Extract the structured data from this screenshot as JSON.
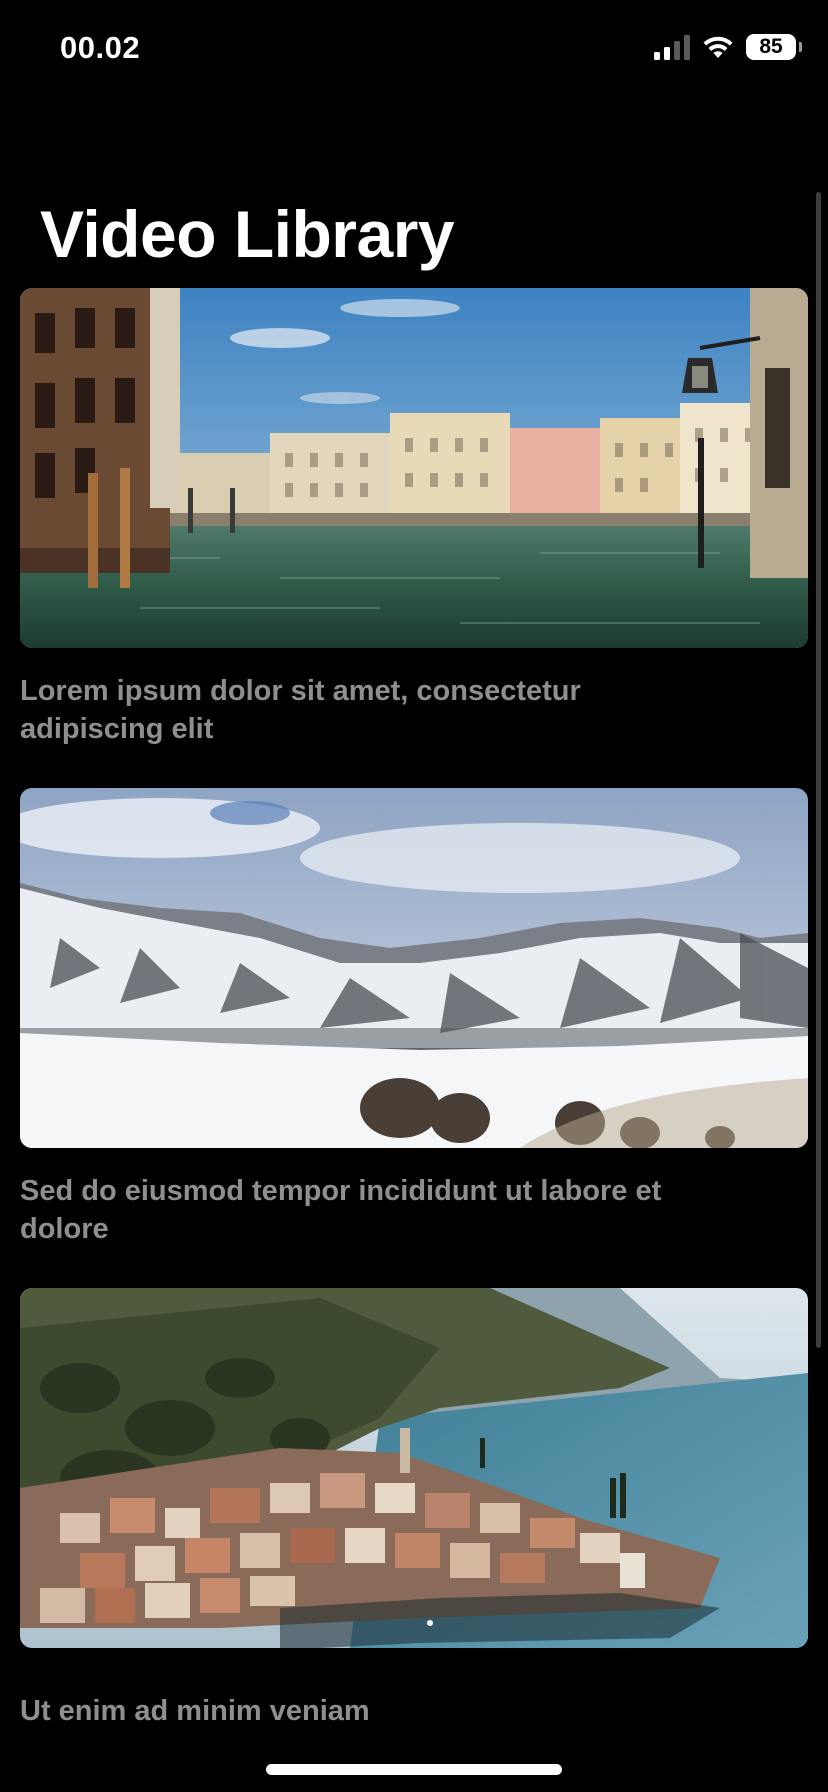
{
  "status_bar": {
    "time": "00.02",
    "battery_level": "85",
    "signal_bars_active": 2,
    "signal_bars_total": 4
  },
  "header": {
    "title": "Video Library"
  },
  "videos": [
    {
      "caption": "Lorem ipsum dolor sit amet, consectetur adipiscing elit",
      "thumbnail": "venice-canal"
    },
    {
      "caption": "Sed do eiusmod tempor incididunt ut labore et dolore",
      "thumbnail": "snowy-mountains"
    },
    {
      "caption": "Ut enim ad minim veniam",
      "thumbnail": "lakeside-village"
    }
  ],
  "colors": {
    "background": "#000000",
    "caption_text": "#8e8e93",
    "title_text": "#ffffff"
  }
}
